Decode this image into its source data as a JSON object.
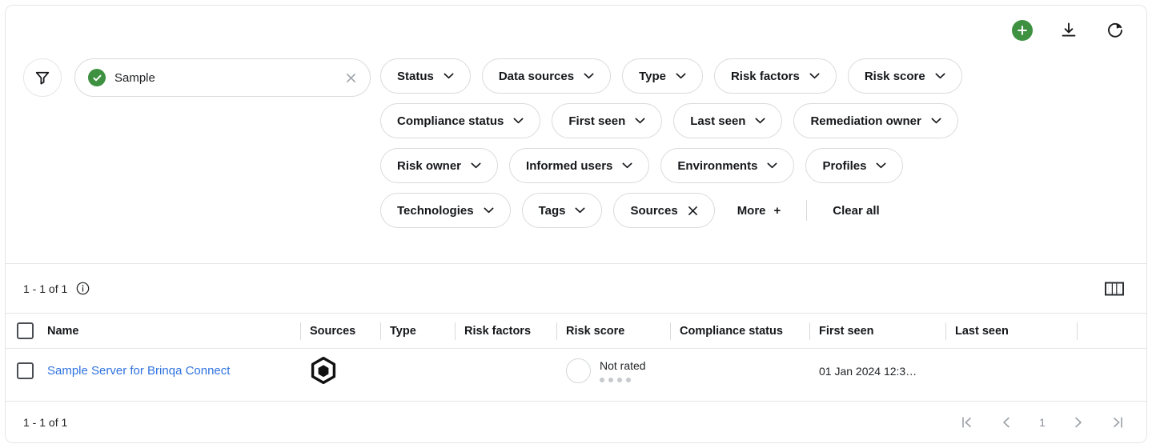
{
  "theme": {
    "green": "#3d9140",
    "link_blue": "#2f72e0",
    "border": "#e4e6e8"
  },
  "toolbar": {
    "add_label": "add",
    "download_label": "download",
    "refresh_label": "refresh"
  },
  "search": {
    "value": "Sample",
    "status_icon": "check-circle-icon",
    "clear_label": "clear"
  },
  "filters": {
    "funnel_label": "filter",
    "row1": [
      {
        "label": "Status",
        "control": "chevron"
      },
      {
        "label": "Data sources",
        "control": "chevron"
      },
      {
        "label": "Type",
        "control": "chevron"
      },
      {
        "label": "Risk factors",
        "control": "chevron"
      },
      {
        "label": "Risk score",
        "control": "chevron"
      }
    ],
    "row2": [
      {
        "label": "Compliance status",
        "control": "chevron"
      },
      {
        "label": "First seen",
        "control": "chevron"
      },
      {
        "label": "Last seen",
        "control": "chevron"
      },
      {
        "label": "Remediation owner",
        "control": "chevron"
      }
    ],
    "row3": [
      {
        "label": "Risk owner",
        "control": "chevron"
      },
      {
        "label": "Informed users",
        "control": "chevron"
      },
      {
        "label": "Environments",
        "control": "chevron"
      },
      {
        "label": "Profiles",
        "control": "chevron"
      }
    ],
    "row4": [
      {
        "label": "Technologies",
        "control": "chevron"
      },
      {
        "label": "Tags",
        "control": "chevron"
      },
      {
        "label": "Sources",
        "control": "close"
      }
    ],
    "more_label": "More",
    "more_plus": "+",
    "clear_all_label": "Clear all"
  },
  "results": {
    "count_text": "1 - 1 of 1",
    "info_label": "info",
    "columns_label": "columns"
  },
  "table": {
    "headers": [
      "Name",
      "Sources",
      "Type",
      "Risk factors",
      "Risk score",
      "Compliance status",
      "First seen",
      "Last seen"
    ],
    "rows": [
      {
        "name": "Sample Server for Brinqa Connect",
        "source_icon": "brinqa-hexagon-logo",
        "type": "",
        "risk_factors": "",
        "risk_score_label": "Not rated",
        "risk_score_dots": 4,
        "compliance_status": "",
        "first_seen": "01 Jan 2024 12:3…",
        "last_seen": ""
      }
    ]
  },
  "footer": {
    "count_text": "1 - 1 of 1",
    "page_number": "1",
    "first_label": "first page",
    "prev_label": "previous page",
    "next_label": "next page",
    "last_label": "last page"
  }
}
